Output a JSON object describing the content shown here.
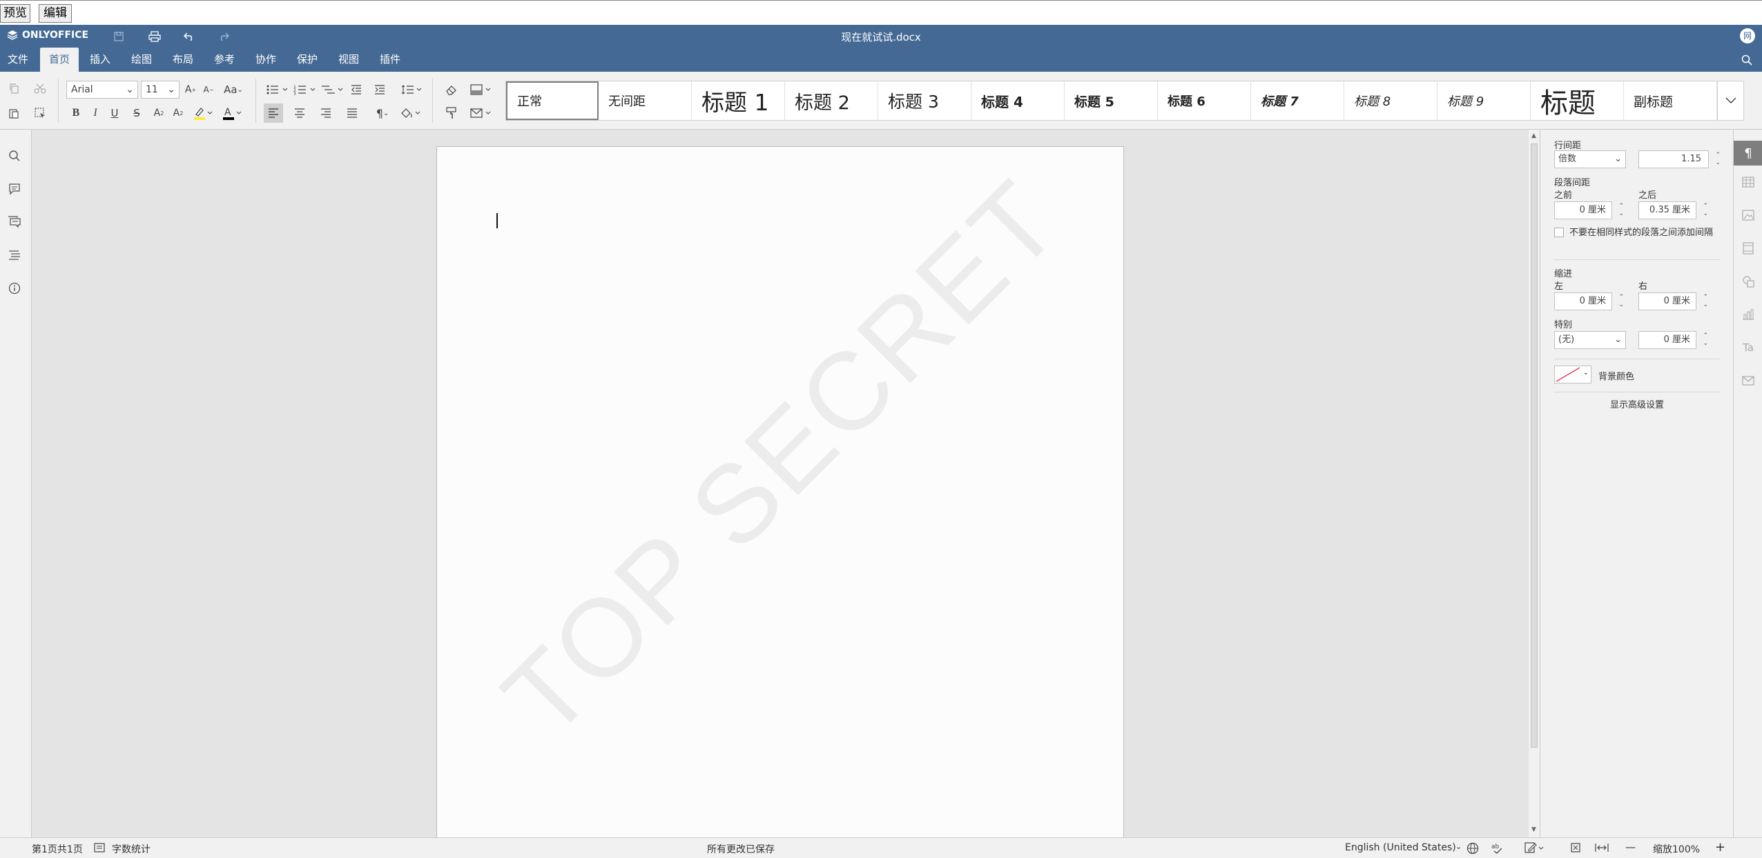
{
  "topstrip": {
    "preview_label": "预览",
    "edit_label": "编辑"
  },
  "app": {
    "brand": "ONLYOFFICE",
    "doc_title": "现在就试试.docx",
    "avatar_initial": "网"
  },
  "tabs": [
    "文件",
    "首页",
    "插入",
    "绘图",
    "布局",
    "参考",
    "协作",
    "保护",
    "视图",
    "插件"
  ],
  "active_tab": "首页",
  "toolbar": {
    "font_name": "Arial",
    "font_size": "11",
    "case_label": "Aa"
  },
  "styles": [
    "正常",
    "无间距",
    "标题 1",
    "标题 2",
    "标题 3",
    "标题 4",
    "标题 5",
    "标题 6",
    "标题 7",
    "标题 8",
    "标题 9",
    "标题",
    "副标题"
  ],
  "document": {
    "watermark": "TOP SECRET"
  },
  "panel": {
    "line_spacing_label": "行间距",
    "line_spacing_mode": "倍数",
    "line_spacing_value": "1.15",
    "para_spacing_label": "段落间距",
    "before_label": "之前",
    "after_label": "之后",
    "before_value": "0 厘米",
    "after_value": "0.35 厘米",
    "no_space_checkbox": "不要在相同样式的段落之间添加间隔",
    "indent_label": "缩进",
    "left_label": "左",
    "right_label": "右",
    "left_value": "0 厘米",
    "right_value": "0 厘米",
    "special_label": "特别",
    "special_mode": "(无)",
    "special_value": "0 厘米",
    "bg_color_label": "背景颜色",
    "advanced_link": "显示高级设置"
  },
  "status": {
    "page_info": "第1页共1页",
    "word_count": "字数统计",
    "save_status": "所有更改已保存",
    "language": "English (United States)",
    "zoom": "缩放100%",
    "zoom_minus": "—",
    "zoom_plus": "+"
  },
  "colors": {
    "header": "#446995",
    "toolbar": "#f1f1f1",
    "highlight": "#ffeb3b",
    "font_color": "#000000"
  }
}
